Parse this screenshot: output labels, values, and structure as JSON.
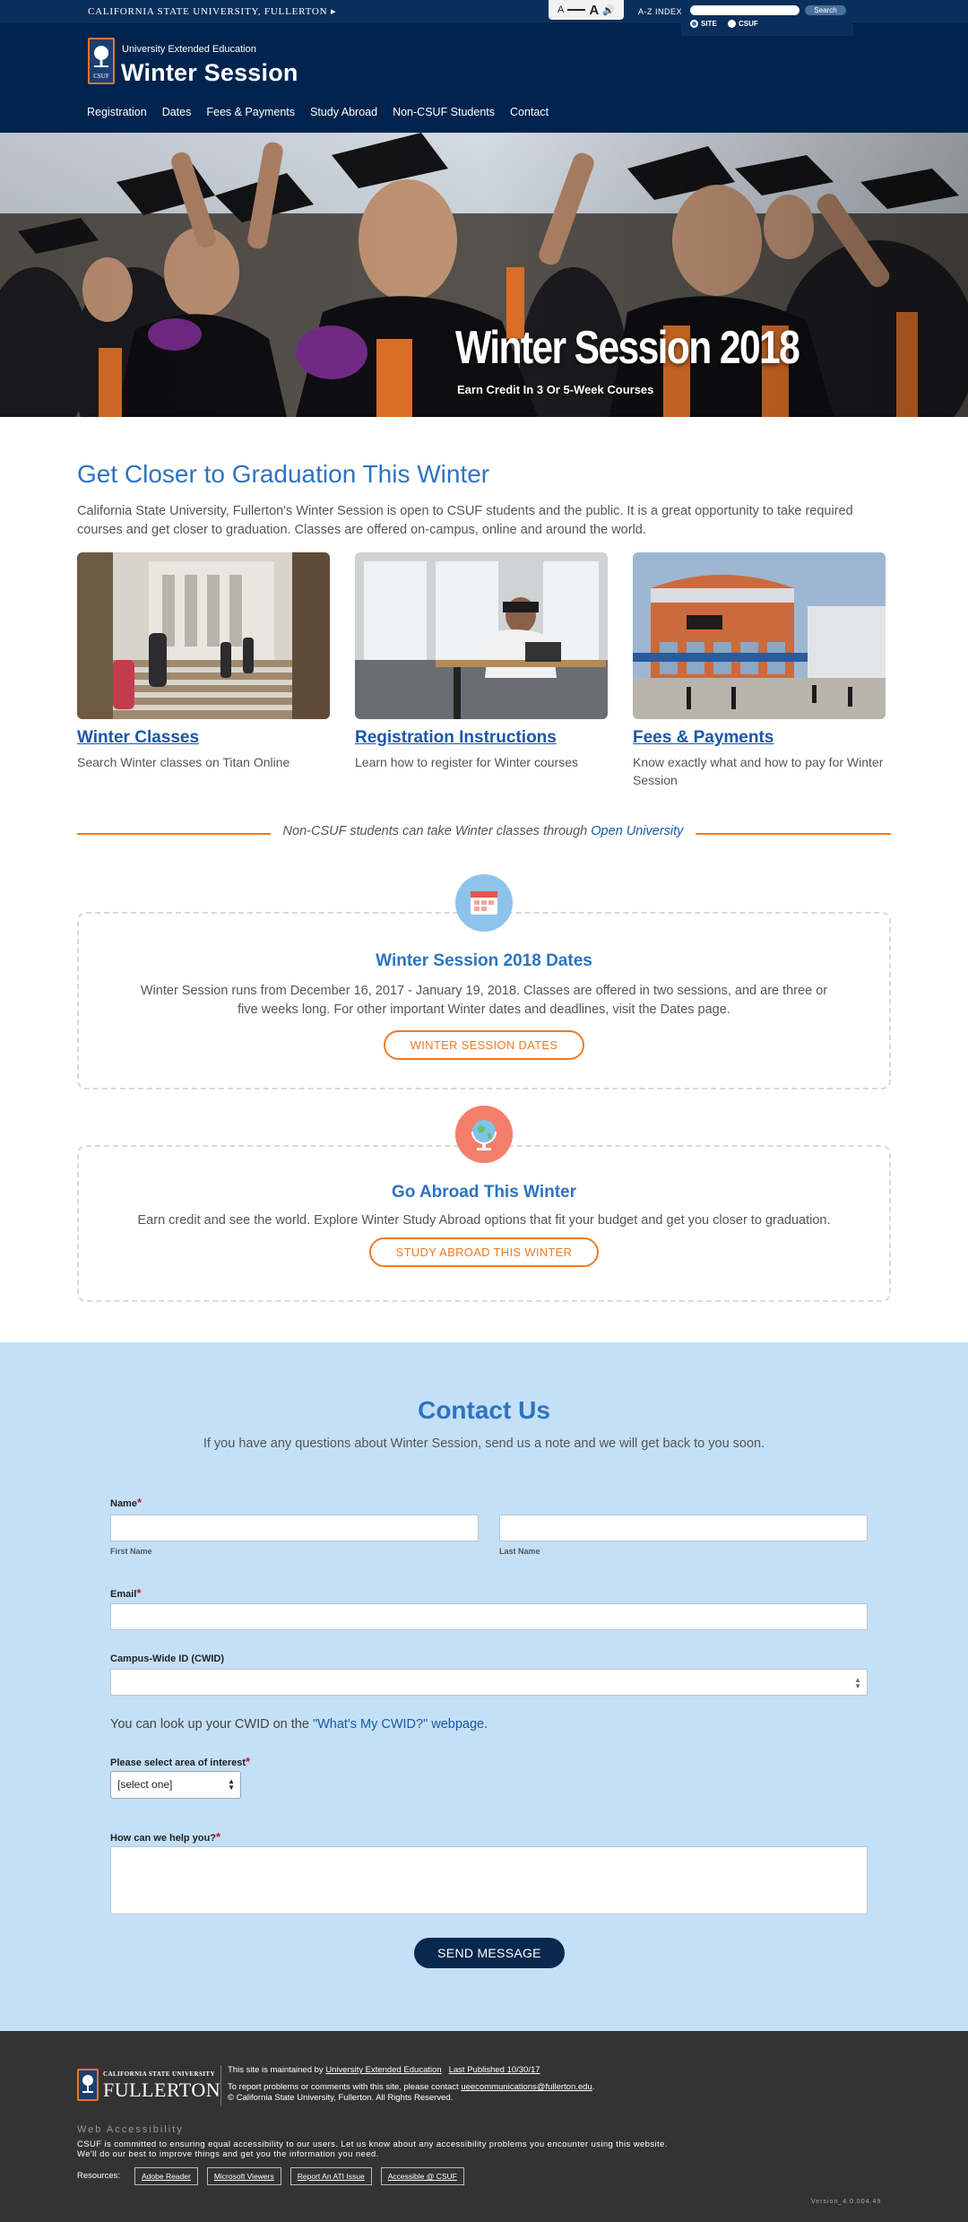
{
  "topbar": {
    "university": "CALIFORNIA STATE UNIVERSITY, FULLERTON ▸",
    "a11y_small": "A",
    "a11y_large": "A",
    "az_index": "A-Z INDEX",
    "search_placeholder": "",
    "search_button": "Search",
    "scope_site": "SITE",
    "scope_csuf": "CSUF"
  },
  "header": {
    "department": "University Extended Education",
    "title": "Winter Session",
    "logo_text": "CSUF",
    "nav": [
      "Registration",
      "Dates",
      "Fees & Payments",
      "Study Abroad",
      "Non-CSUF Students",
      "Contact"
    ]
  },
  "hero": {
    "title": "Winter Session 2018",
    "subtitle": "Earn Credit In 3 Or 5-Week Courses"
  },
  "intro": {
    "heading": "Get Closer to Graduation This Winter",
    "text": "California State University, Fullerton's Winter Session is open to CSUF students and the public. It is a great opportunity to take required courses and get closer to graduation. Classes are offered on-campus, online and around the world."
  },
  "cards": [
    {
      "title": "Winter Classes",
      "desc": "Search Winter classes on Titan Online"
    },
    {
      "title": "Registration Instructions",
      "desc": "Learn how to register for Winter courses"
    },
    {
      "title": "Fees & Payments",
      "desc": "Know exactly what and how to pay for Winter Session"
    }
  ],
  "divider": {
    "text": "Non-CSUF students can take Winter classes through ",
    "link": "Open University"
  },
  "features": {
    "dates": {
      "title": "Winter Session 2018 Dates",
      "text": "Winter Session runs from December 16, 2017 - January 19, 2018. Classes are offered in two sessions, and are three or five weeks long. For other important Winter dates and deadlines, visit the Dates page.",
      "button": "WINTER SESSION DATES",
      "icon": "calendar-icon"
    },
    "abroad": {
      "title": "Go Abroad This Winter",
      "text": "Earn credit and see the world. Explore Winter Study Abroad options that fit your budget and get you closer to graduation.",
      "button": "STUDY ABROAD THIS WINTER",
      "icon": "globe-icon"
    }
  },
  "contact": {
    "heading": "Contact Us",
    "intro": "If you have any questions about Winter Session, send us a note and we will get back to you soon.",
    "name_label": "Name",
    "first_name_label": "First Name",
    "last_name_label": "Last Name",
    "email_label": "Email",
    "cwid_label": "Campus-Wide ID (CWID)",
    "cwid_help_prefix": "You can look up your CWID on the ",
    "cwid_help_link": "\"What's My CWID?\" webpage",
    "cwid_help_suffix": ".",
    "interest_label": "Please select area of interest",
    "interest_value": "[select one]",
    "help_label": "How can we help you?",
    "required_mark": "*",
    "send_button": "SEND MESSAGE"
  },
  "footer": {
    "logo_small": "CALIFORNIA STATE UNIVERSITY",
    "logo_big": "FULLERTON",
    "maintained_prefix": "This site is maintained by ",
    "maintained_link": "University Extended Education",
    "last_published": "Last Published 10/30/17",
    "report_prefix": "To report problems or comments with this site, please contact ",
    "report_email": "ueecommunications@fullerton.edu",
    "report_suffix": ".",
    "copyright": "© California State University, Fullerton. All Rights Reserved.",
    "a11y_heading": "Web Accessibility",
    "a11y_text_1": "CSUF is committed to ensuring equal accessibility to our users. Let us know about any accessibility problems you encounter using this website.",
    "a11y_text_2": "We'll do our best to improve things and get you the information you need.",
    "resources_label": "Resources:",
    "resources": [
      "Adobe Reader",
      "Microsoft Viewers",
      "Report An ATI Issue",
      "Accessible @ CSUF"
    ],
    "version": "Version_4.0.004.49"
  },
  "colors": {
    "navy": "#00244e",
    "accent_blue": "#2e73c0",
    "orange": "#ef7b22",
    "contact_bg": "#c3e0f7",
    "footer_bg": "#333333"
  }
}
